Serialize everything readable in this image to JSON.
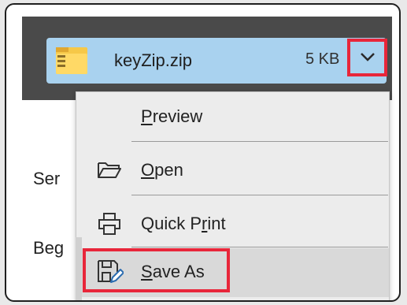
{
  "attachment": {
    "filename": "keyZip.zip",
    "size": "5 KB",
    "icon": "zip-folder-icon",
    "accent": "#a9d2ef"
  },
  "background_text": {
    "line1": "Ser",
    "line2": "Beg"
  },
  "menu": {
    "items": [
      {
        "label_pre": "",
        "label_u": "P",
        "label_post": "review",
        "icon": ""
      },
      {
        "label_pre": "",
        "label_u": "O",
        "label_post": "pen",
        "icon": "folder-open-icon"
      },
      {
        "label_pre": "Quick P",
        "label_u": "r",
        "label_post": "int",
        "icon": "printer-icon"
      },
      {
        "label_pre": "",
        "label_u": "S",
        "label_post": "ave As",
        "icon": "save-as-icon"
      }
    ]
  },
  "highlight_color": "#e8263a"
}
